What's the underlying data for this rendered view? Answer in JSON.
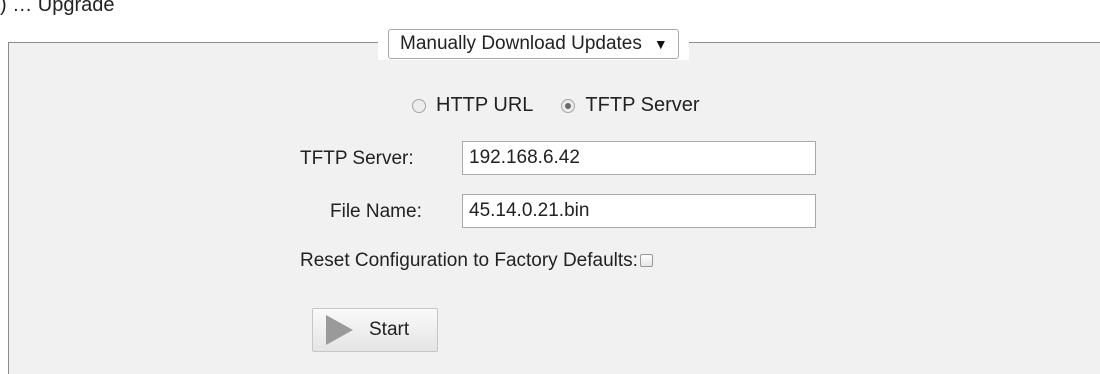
{
  "page": {
    "top_fragment": ") … Upgrade"
  },
  "section": {
    "mode_select": {
      "value": "Manually Download Updates",
      "caret": "▼"
    }
  },
  "source": {
    "options": [
      {
        "label": "HTTP URL",
        "checked": false
      },
      {
        "label": "TFTP Server",
        "checked": true
      }
    ]
  },
  "form": {
    "tftp_server_label": "TFTP Server:",
    "tftp_server_value": "192.168.6.42",
    "file_name_label": "File Name:",
    "file_name_value": "45.14.0.21.bin",
    "reset_label": "Reset Configuration to Factory Defaults:",
    "reset_checked": false
  },
  "actions": {
    "start_label": "Start",
    "start_icon": "play-icon"
  },
  "colors": {
    "panel_bg": "#f1f1f1",
    "panel_border": "#8c8c8c",
    "play_icon_fill": "#9a9a9a"
  }
}
